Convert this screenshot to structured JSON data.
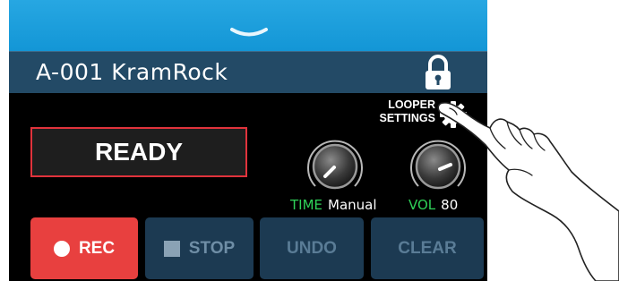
{
  "patch": {
    "name": "A-001 KramRock"
  },
  "looper_settings": {
    "line1": "LOOPER",
    "line2": "SETTINGS"
  },
  "status": {
    "text": "READY"
  },
  "params": {
    "time": {
      "label": "TIME",
      "value": "Manual"
    },
    "volume": {
      "label": "VOL",
      "value": "80"
    }
  },
  "buttons": {
    "rec": "REC",
    "stop": "STOP",
    "undo": "UNDO",
    "clear": "CLEAR"
  },
  "colors": {
    "top_bar": "#1396d6",
    "patch_bar": "#234a66",
    "rec_button": "#e8403f",
    "status_border": "#e0333c",
    "param_label": "#2fd158",
    "inactive_button": "#1c3a52"
  },
  "icons": [
    "chevron-down-icon",
    "lock-icon",
    "gear-icon",
    "rec-dot-icon",
    "stop-square-icon"
  ]
}
